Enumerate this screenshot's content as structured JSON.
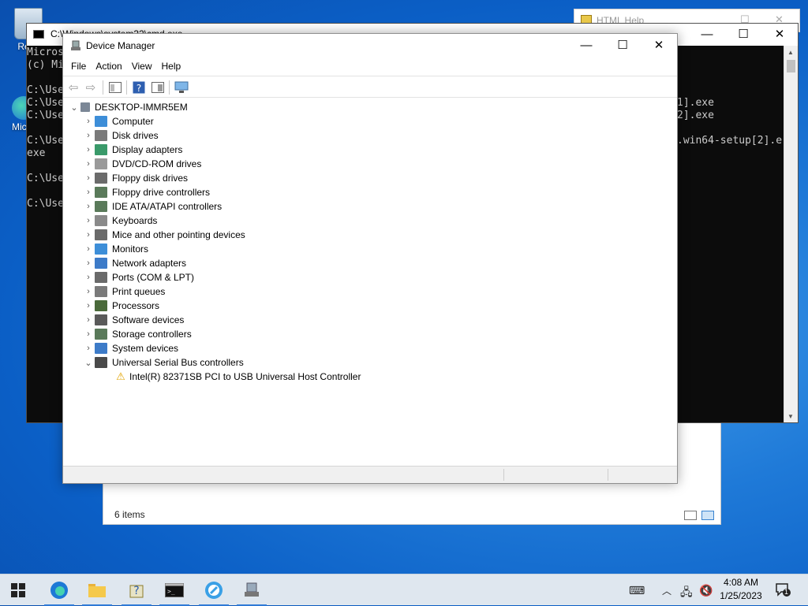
{
  "desktop": {
    "icons": [
      {
        "label": "Recy",
        "icon": "recycle-bin-icon"
      },
      {
        "label": "Mic E",
        "icon": "edge-icon"
      }
    ]
  },
  "back_window": {
    "status_count": "6 items"
  },
  "help_window": {
    "title": "HTML Help"
  },
  "cmd_window": {
    "title": "C:\\Windows\\system32\\cmd.exe",
    "lines": [
      "Micros",
      "(c) Mi",
      "",
      "C:\\Use",
      "C:\\Use",
      "C:\\Use",
      "",
      "C:\\Use",
      "exe",
      "",
      "C:\\Use",
      "",
      "C:\\Use"
    ],
    "right_fragments": [
      "1].exe",
      "2].exe",
      "",
      ".win64-setup[2].e"
    ]
  },
  "device_manager": {
    "title": "Device Manager",
    "menu": [
      "File",
      "Action",
      "View",
      "Help"
    ],
    "toolbar": [
      "back-icon",
      "forward-icon",
      "show-hide-tree-icon",
      "help-icon",
      "properties-icon",
      "scan-hardware-icon"
    ],
    "root": "DESKTOP-IMMR5EM",
    "categories": [
      {
        "label": "Computer",
        "icon": "computer-icon",
        "color": "#3d8ed8",
        "expanded": false
      },
      {
        "label": "Disk drives",
        "icon": "disk-drive-icon",
        "color": "#7a7a7a",
        "expanded": false
      },
      {
        "label": "Display adapters",
        "icon": "display-adapter-icon",
        "color": "#3a9a6a",
        "expanded": false
      },
      {
        "label": "DVD/CD-ROM drives",
        "icon": "dvd-drive-icon",
        "color": "#9a9a9a",
        "expanded": false
      },
      {
        "label": "Floppy disk drives",
        "icon": "floppy-disk-icon",
        "color": "#6b6b6b",
        "expanded": false
      },
      {
        "label": "Floppy drive controllers",
        "icon": "floppy-controller-icon",
        "color": "#5a7a5a",
        "expanded": false
      },
      {
        "label": "IDE ATA/ATAPI controllers",
        "icon": "ide-controller-icon",
        "color": "#5a7a5a",
        "expanded": false
      },
      {
        "label": "Keyboards",
        "icon": "keyboard-icon",
        "color": "#8a8a8a",
        "expanded": false
      },
      {
        "label": "Mice and other pointing devices",
        "icon": "mouse-icon",
        "color": "#6a6a6a",
        "expanded": false
      },
      {
        "label": "Monitors",
        "icon": "monitor-icon",
        "color": "#3d8ed8",
        "expanded": false
      },
      {
        "label": "Network adapters",
        "icon": "network-adapter-icon",
        "color": "#3d7bc8",
        "expanded": false
      },
      {
        "label": "Ports (COM & LPT)",
        "icon": "port-icon",
        "color": "#6a6a6a",
        "expanded": false
      },
      {
        "label": "Print queues",
        "icon": "printer-icon",
        "color": "#7a7a7a",
        "expanded": false
      },
      {
        "label": "Processors",
        "icon": "processor-icon",
        "color": "#4a6a3a",
        "expanded": false
      },
      {
        "label": "Software devices",
        "icon": "software-device-icon",
        "color": "#5a5a5a",
        "expanded": false
      },
      {
        "label": "Storage controllers",
        "icon": "storage-controller-icon",
        "color": "#5a7a5a",
        "expanded": false
      },
      {
        "label": "System devices",
        "icon": "system-devices-icon",
        "color": "#3d7bc8",
        "expanded": false
      },
      {
        "label": "Universal Serial Bus controllers",
        "icon": "usb-icon",
        "color": "#4a4a4a",
        "expanded": true,
        "children": [
          {
            "label": "Intel(R) 82371SB PCI to USB Universal Host Controller",
            "icon": "warning-icon"
          }
        ]
      }
    ]
  },
  "taskbar": {
    "apps": [
      {
        "name": "start",
        "icon": "windows-start-icon",
        "running": false
      },
      {
        "name": "edge",
        "icon": "edge-icon",
        "running": true
      },
      {
        "name": "file-explorer",
        "icon": "folder-icon",
        "running": true
      },
      {
        "name": "html-help",
        "icon": "help-icon",
        "running": true
      },
      {
        "name": "cmd",
        "icon": "terminal-icon",
        "running": true
      },
      {
        "name": "app",
        "icon": "app-icon",
        "running": true
      },
      {
        "name": "device-manager",
        "icon": "device-manager-icon",
        "running": true
      }
    ],
    "time": "4:08 AM",
    "date": "1/25/2023",
    "notification_count": "1"
  }
}
